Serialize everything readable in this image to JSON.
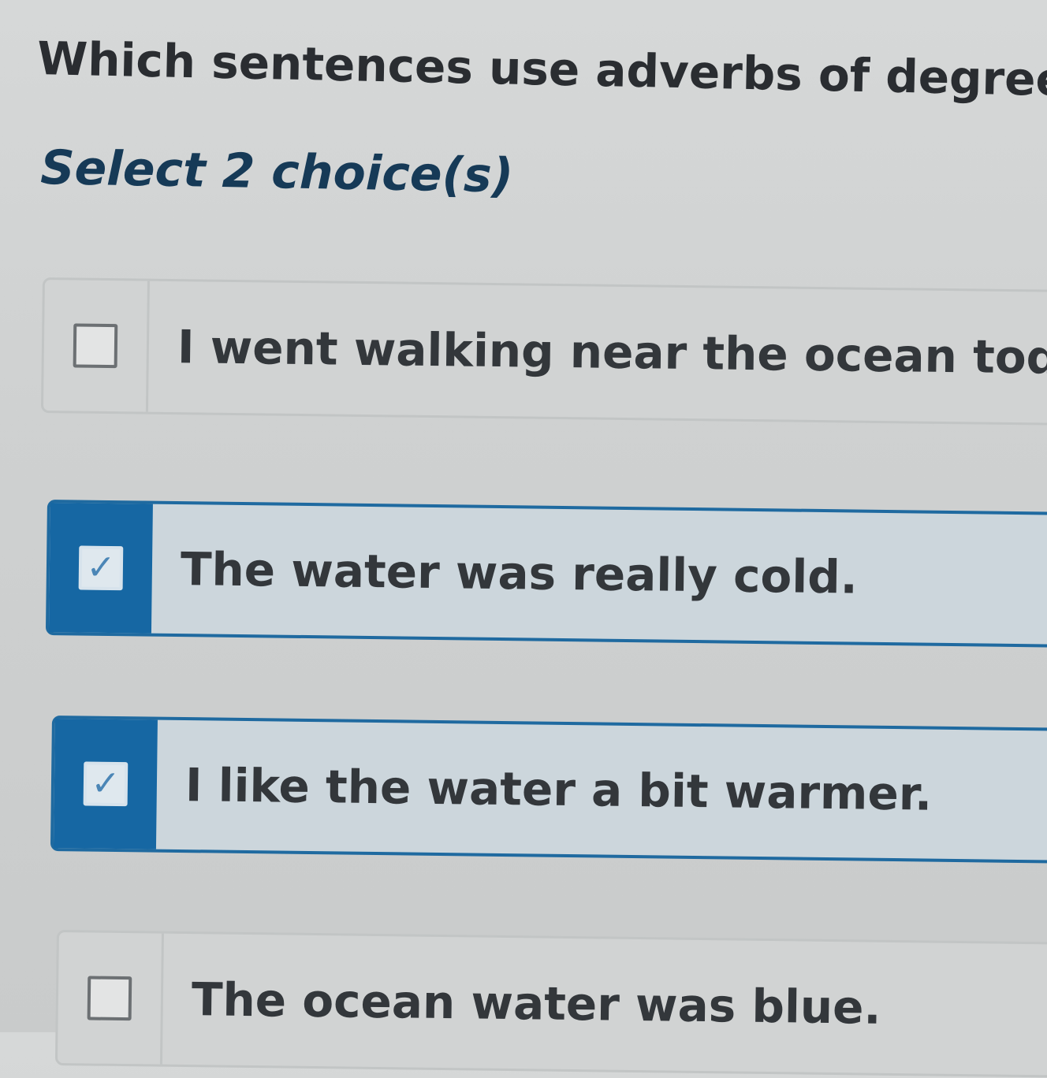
{
  "question": "Which sentences use adverbs of degrees?",
  "instruction": "Select 2 choice(s)",
  "choices": [
    {
      "text": "I went walking near the ocean today.",
      "selected": false
    },
    {
      "text": "The water was really cold.",
      "selected": true
    },
    {
      "text": "I like the water a bit warmer.",
      "selected": true
    },
    {
      "text": "The ocean water was blue.",
      "selected": false
    }
  ],
  "colors": {
    "selected_accent": "#1667a3",
    "selected_border": "#1f6aa0",
    "background": "#d1d3d3"
  },
  "icons": {
    "checked": "checkmark-icon",
    "unchecked": "empty-checkbox-icon"
  }
}
